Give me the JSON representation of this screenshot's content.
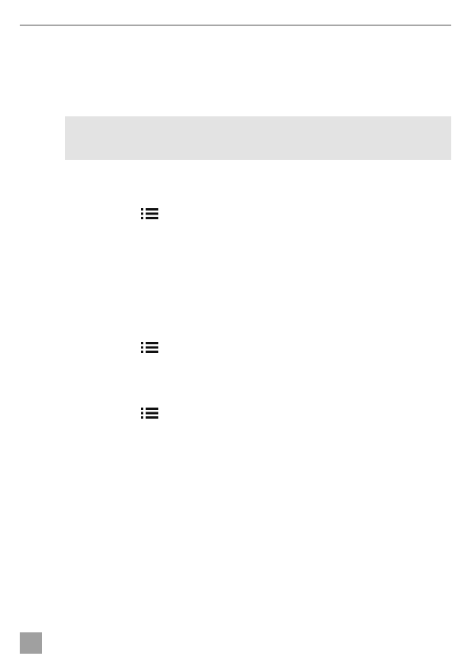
{
  "page": {
    "header": {},
    "note_box": {},
    "list_icons": [
      {
        "icon": "list-icon"
      },
      {
        "icon": "list-icon"
      },
      {
        "icon": "list-icon"
      }
    ],
    "footer": {}
  },
  "colors": {
    "rule": "#a8a8a8",
    "note_box": "#e3e3e3",
    "page_marker": "#a0a0a0",
    "icon": "#111111"
  }
}
